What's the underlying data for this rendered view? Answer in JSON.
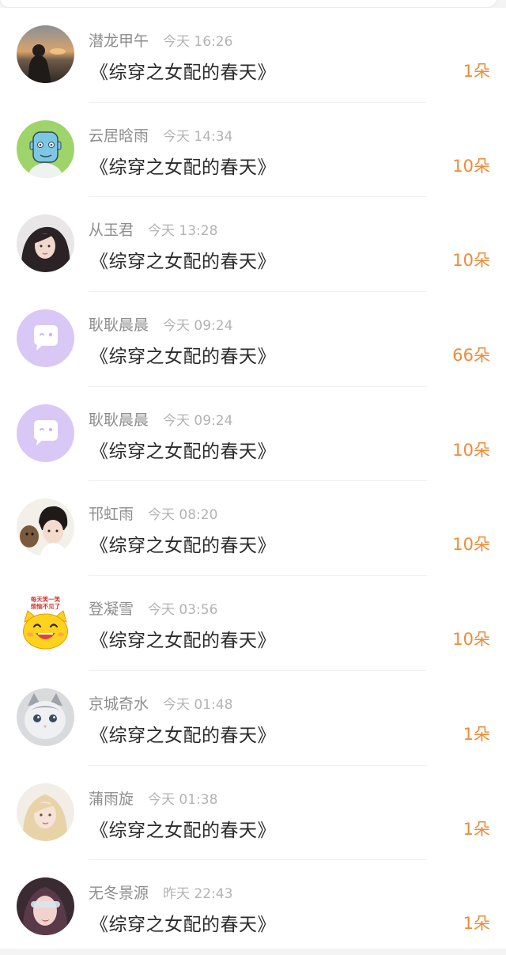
{
  "rows": [
    {
      "name": "潜龙甲午",
      "time": "今天 16:26",
      "title": "《综穿之女配的春天》",
      "gift": "1朵",
      "avatar": "sunset-silhouette-avatar"
    },
    {
      "name": "云居晗雨",
      "time": "今天 14:34",
      "title": "《综穿之女配的春天》",
      "gift": "10朵",
      "avatar": "cartoon-blue-face-avatar"
    },
    {
      "name": "从玉君",
      "time": "今天 13:28",
      "title": "《综穿之女配的春天》",
      "gift": "10朵",
      "avatar": "girl-long-hair-avatar"
    },
    {
      "name": "耿耿晨晨",
      "time": "今天 09:24",
      "title": "《综穿之女配的春天》",
      "gift": "66朵",
      "avatar": "default-chat-bubble-avatar"
    },
    {
      "name": "耿耿晨晨",
      "time": "今天 09:24",
      "title": "《综穿之女配的春天》",
      "gift": "10朵",
      "avatar": "default-chat-bubble-avatar"
    },
    {
      "name": "邗虹雨",
      "time": "今天 08:20",
      "title": "《综穿之女配的春天》",
      "gift": "10朵",
      "avatar": "boy-with-pet-avatar"
    },
    {
      "name": "登凝雪",
      "time": "今天 03:56",
      "title": "《综穿之女配的春天》",
      "gift": "10朵",
      "avatar": "yellow-smiley-cat-avatar",
      "avatar_text": "每天笑一笑 烦恼不见了"
    },
    {
      "name": "京城奇水",
      "time": "今天 01:48",
      "title": "《综穿之女配的春天》",
      "gift": "1朵",
      "avatar": "grey-cat-avatar"
    },
    {
      "name": "蒲雨旋",
      "time": "今天 01:38",
      "title": "《综穿之女配的春天》",
      "gift": "1朵",
      "avatar": "blonde-girl-avatar"
    },
    {
      "name": "无冬景源",
      "time": "昨天 22:43",
      "title": "《综穿之女配的春天》",
      "gift": "1朵",
      "avatar": "girl-sunglasses-avatar"
    }
  ],
  "colors": {
    "accent": "#f08a36",
    "name": "#8d8d8d",
    "time": "#b3b3b3",
    "title": "#2b2b2b",
    "default_avatar": "#d9c7f5"
  }
}
